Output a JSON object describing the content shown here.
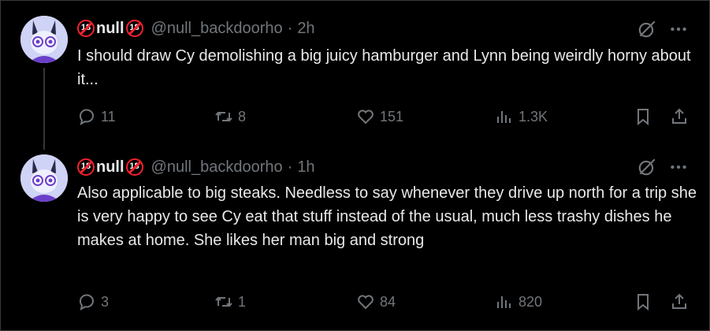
{
  "tweets": [
    {
      "display_name": "null",
      "badge_label": "18",
      "handle": "@null_backdoorho",
      "separator": "·",
      "time": "2h",
      "text": "I should draw Cy demolishing a big juicy hamburger and Lynn being weirdly horny about it...",
      "replies": "11",
      "reposts": "8",
      "likes": "151",
      "views": "1.3K"
    },
    {
      "display_name": "null",
      "badge_label": "18",
      "handle": "@null_backdoorho",
      "separator": "·",
      "time": "1h",
      "text": "Also applicable to big steaks. Needless to say whenever they drive up north for a trip she is very happy to see Cy eat that stuff instead of the usual, much less trashy dishes he makes at home. She likes her man big and strong",
      "replies": "3",
      "reposts": "1",
      "likes": "84",
      "views": "820"
    }
  ],
  "icons": [
    "reply-icon",
    "repost-icon",
    "like-icon",
    "views-icon",
    "bookmark-icon",
    "share-icon",
    "grok-icon",
    "more-icon"
  ],
  "colors": {
    "background": "#000000",
    "text": "#e7e9ea",
    "muted": "#71767b",
    "badge": "#f4212e",
    "avatar_bg": "#cfd3f5",
    "avatar_accent": "#6b3fc9"
  }
}
